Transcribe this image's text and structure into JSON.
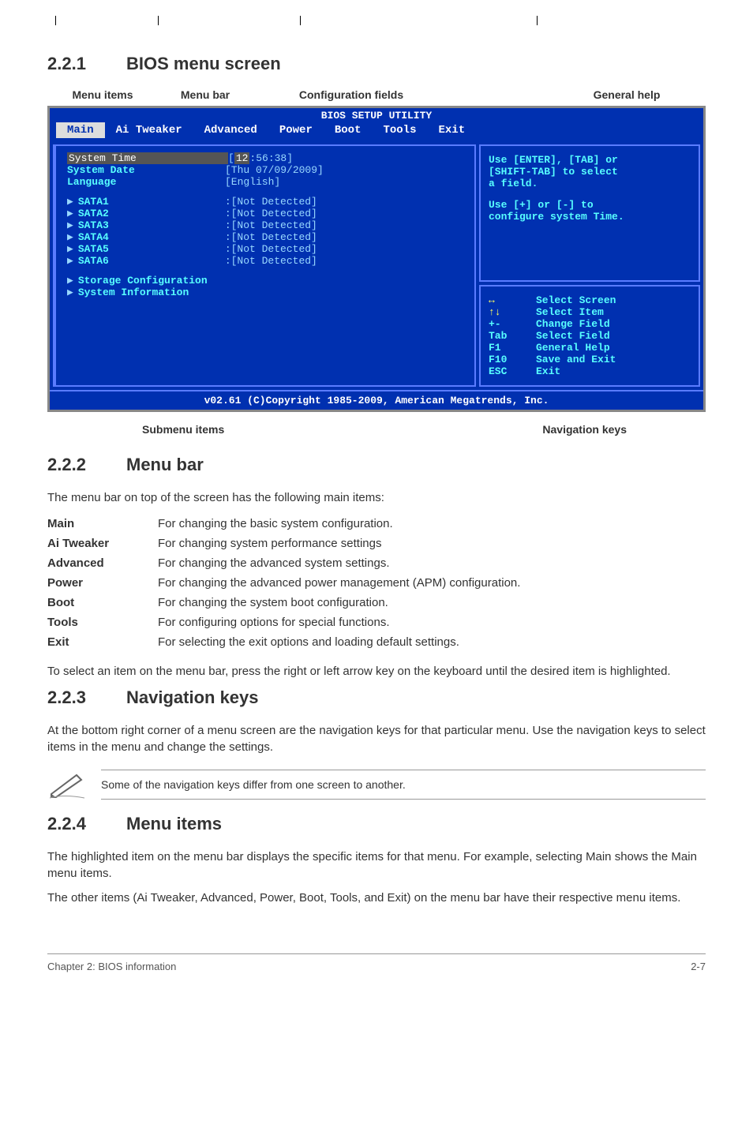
{
  "s1": {
    "num": "2.2.1",
    "title": "BIOS menu screen"
  },
  "labels": {
    "mi": "Menu items",
    "mb": "Menu bar",
    "cf": "Configuration fields",
    "gh": "General help"
  },
  "bios": {
    "title": "BIOS SETUP UTILITY",
    "tabs": [
      "Main",
      "Ai Tweaker",
      "Advanced",
      "Power",
      "Boot",
      "Tools",
      "Exit"
    ],
    "left": {
      "systime": {
        "k": "System Time",
        "v": "[12:56:38]",
        "hl": "12"
      },
      "sysdate": {
        "k": "System Date",
        "v": "[Thu 07/09/2009]"
      },
      "lang": {
        "k": "Language",
        "v": "[English]"
      },
      "sata": [
        {
          "k": "SATA1",
          "v": ":[Not Detected]"
        },
        {
          "k": "SATA2",
          "v": ":[Not Detected]"
        },
        {
          "k": "SATA3",
          "v": ":[Not Detected]"
        },
        {
          "k": "SATA4",
          "v": ":[Not Detected]"
        },
        {
          "k": "SATA5",
          "v": ":[Not Detected]"
        },
        {
          "k": "SATA6",
          "v": ":[Not Detected]"
        }
      ],
      "storage": "Storage Configuration",
      "sysinfo": "System Information"
    },
    "help": {
      "l1": "Use [ENTER], [TAB] or",
      "l2": "[SHIFT-TAB] to select",
      "l3": "a field.",
      "l4": "Use [+] or [-] to",
      "l5": "configure system Time."
    },
    "nav": [
      {
        "a": "↔",
        "b": "Select Screen"
      },
      {
        "a": "↑↓",
        "b": "Select Item"
      },
      {
        "a": "+-",
        "b": "Change Field"
      },
      {
        "a": "Tab",
        "b": "Select Field"
      },
      {
        "a": "F1",
        "b": "General Help"
      },
      {
        "a": "F10",
        "b": "Save and Exit"
      },
      {
        "a": "ESC",
        "b": "Exit"
      }
    ],
    "copyright": "v02.61 (C)Copyright 1985-2009, American Megatrends, Inc."
  },
  "sublabels": {
    "sm": "Submenu items",
    "nk": "Navigation keys"
  },
  "s2": {
    "num": "2.2.2",
    "title": "Menu bar",
    "intro": "The menu bar on top of the screen has the following main items:",
    "rows": [
      {
        "t": "Main",
        "d": "For changing the basic system configuration."
      },
      {
        "t": "Ai Tweaker",
        "d": "For changing system performance settings"
      },
      {
        "t": "Advanced",
        "d": "For changing the advanced system settings."
      },
      {
        "t": "Power",
        "d": "For changing the advanced power management (APM) configuration."
      },
      {
        "t": "Boot",
        "d": "For changing the system boot configuration."
      },
      {
        "t": "Tools",
        "d": "For configuring options for special functions."
      },
      {
        "t": "Exit",
        "d": "For selecting the exit options and loading default settings."
      }
    ],
    "outro": "To select an item on the menu bar, press the right or left arrow key on the keyboard until the desired item is highlighted."
  },
  "s3": {
    "num": "2.2.3",
    "title": "Navigation keys",
    "p": "At the bottom right corner of a menu screen are the navigation keys for that particular menu. Use the navigation keys to select items in the menu and change the settings.",
    "note": "Some of the navigation keys differ from one screen to another."
  },
  "s4": {
    "num": "2.2.4",
    "title": "Menu items",
    "p1": "The highlighted item on the menu bar displays the specific items for that menu. For example, selecting Main shows the Main menu items.",
    "p2": "The other items (Ai Tweaker, Advanced, Power, Boot, Tools, and Exit) on the menu bar have their respective menu items."
  },
  "footer": {
    "l": "Chapter 2: BIOS information",
    "r": "2-7"
  }
}
